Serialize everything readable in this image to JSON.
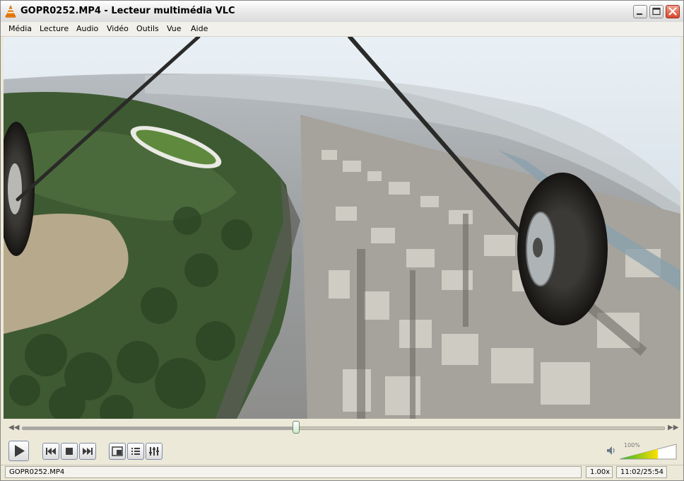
{
  "window": {
    "title": "GOPR0252.MP4 - Lecteur multimédia VLC",
    "buttons": [
      "minimize",
      "maximize",
      "close"
    ]
  },
  "menu": {
    "items": [
      "Média",
      "Lecture",
      "Audio",
      "Vidéo",
      "Outils",
      "Vue",
      "Aide"
    ]
  },
  "video": {
    "description": "aerial view over city and park with wheel and strut in foreground"
  },
  "playback": {
    "progress": 0.427,
    "state": "paused"
  },
  "volume": {
    "label": "100%",
    "level": 1.0
  },
  "status": {
    "filename": "GOPR0252.MP4",
    "speed": "1.00x",
    "time": "11:02/25:54"
  },
  "icons": {
    "app": "vlc-cone-icon",
    "play": "play-icon",
    "prev": "previous-icon",
    "stop": "stop-icon",
    "next": "next-icon",
    "fullscreen": "fullscreen-icon",
    "playlist": "playlist-icon",
    "settings": "extended-settings-icon",
    "speaker": "speaker-icon"
  },
  "colors": {
    "accent": "#f07d00",
    "chrome": "#ece9d8",
    "volume_start": "#2fb32f",
    "volume_end": "#ffe000"
  }
}
